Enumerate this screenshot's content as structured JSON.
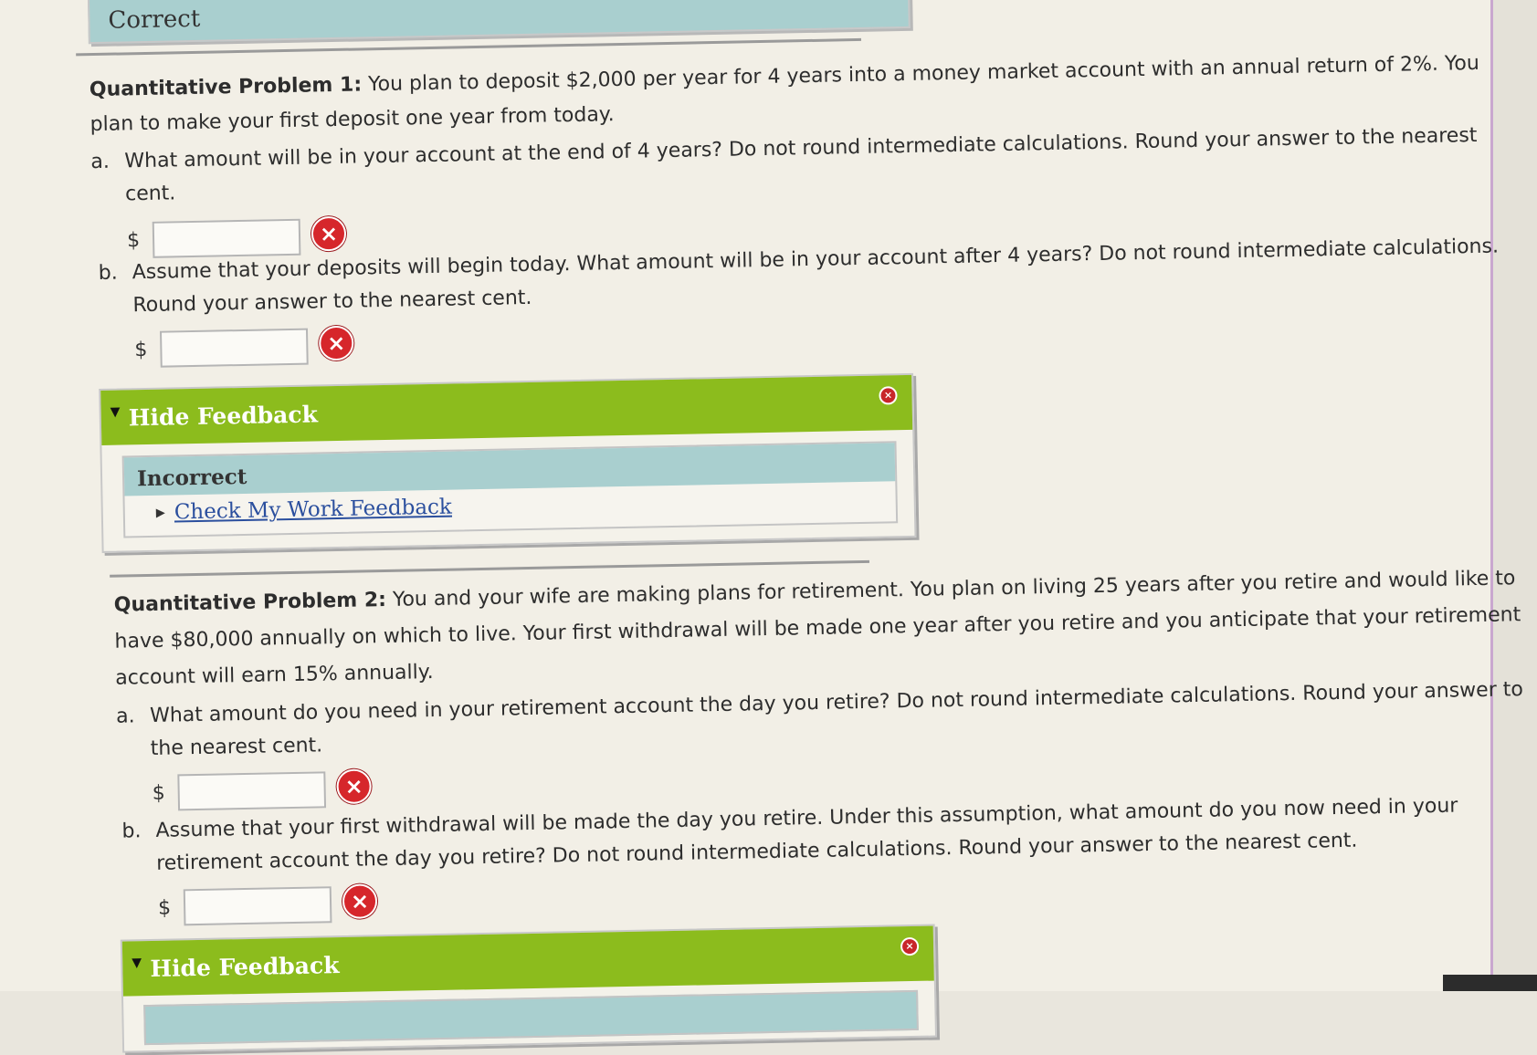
{
  "top_status": "Correct",
  "problem1": {
    "label": "Quantitative Problem 1:",
    "text_line1": " You plan to deposit $2,000 per year for 4 years into a money market account with an annual return of 2%. You",
    "text_line2": "plan to make your first deposit one year from today.",
    "qa": {
      "letter": "a.",
      "line1": "What amount will be in your account at the end of 4 years? Do not round intermediate calculations. Round your answer to the nearest",
      "line2": "cent.",
      "currency": "$",
      "value": ""
    },
    "qb": {
      "letter": "b.",
      "line1": "Assume that your deposits will begin today. What amount will be in your account after 4 years? Do not round intermediate calculations.",
      "line2": "Round your answer to the nearest cent.",
      "currency": "$",
      "value": ""
    },
    "feedback": {
      "toggle_icon": "▼",
      "title": "Hide Feedback",
      "close_icon": "×",
      "status": "Incorrect",
      "link_arrow": "▶",
      "link_label": "Check My Work Feedback"
    }
  },
  "problem2": {
    "label": "Quantitative Problem 2:",
    "text_line1": " You and your wife are making plans for retirement. You plan on living 25 years after you retire and would like to",
    "text_line2": "have $80,000 annually on which to live. Your first withdrawal will be made one year after you retire and you anticipate that your retirement",
    "text_line3": "account will earn 15% annually.",
    "qa": {
      "letter": "a.",
      "line1": "What amount do you need in your retirement account the day you retire? Do not round intermediate calculations. Round your answer to",
      "line2": "the nearest cent.",
      "currency": "$",
      "value": ""
    },
    "qb": {
      "letter": "b.",
      "line1": "Assume that your first withdrawal will be made the day you retire. Under this assumption, what amount do you now need in your",
      "line2": "retirement account the day you retire? Do not round intermediate calculations. Round your answer to the nearest cent.",
      "currency": "$",
      "value": ""
    },
    "feedback": {
      "toggle_icon": "▼",
      "title": "Hide Feedback",
      "close_icon": "×"
    }
  },
  "incorrect_icon": "×",
  "colors": {
    "feedback_header": "#8cbc1d",
    "status_bg": "#a9cfcf",
    "error_badge": "#d6262b",
    "link": "#2b4f9e"
  }
}
